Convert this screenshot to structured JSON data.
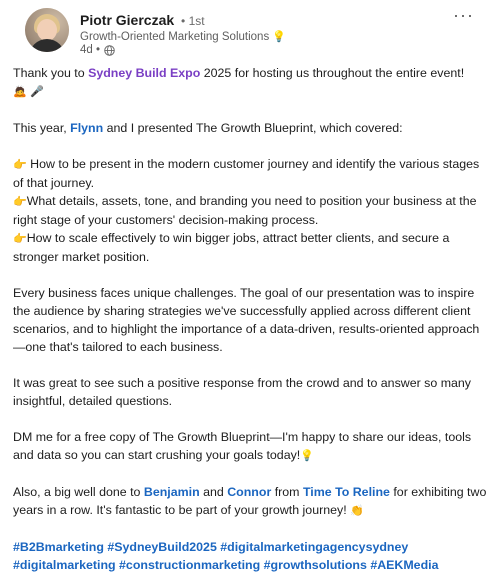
{
  "header": {
    "name": "Piotr Gierczak",
    "degree": "• 1st",
    "headline": "Growth-Oriented Marketing Solutions",
    "headline_emoji": "💡",
    "time": "4d •",
    "more": "···"
  },
  "post": {
    "line1_pre": "Thank you to ",
    "line1_tag": "Sydney Build Expo",
    "line1_post": " 2025 for hosting us throughout the entire event!",
    "line1_emoji": "🙇 🎤",
    "line2_pre": "This year, ",
    "line2_tag": "Flynn",
    "line2_post": " and I presented The Growth Blueprint, which covered:",
    "bullet_emoji": "👉",
    "bullet1": " How to be present in the modern customer journey and identify the various stages of that journey.",
    "bullet2": "What details, assets, tone, and branding you need to position your business at the right stage of your customers' decision-making process.",
    "bullet3": "How to scale effectively to win bigger jobs, attract better clients, and secure a stronger market position.",
    "para1": "Every business faces unique challenges. The goal of our presentation was to inspire the audience by sharing strategies we've successfully applied across different client scenarios, and to highlight the importance of a data-driven, results-oriented approach—one that's tailored to each business.",
    "para2": "It was great to see such a positive response from the crowd and to answer so many insightful, detailed questions.",
    "para3": "DM me for a free copy of The Growth Blueprint—I'm happy to share our ideas, tools and data so you can start crushing your goals today!",
    "para3_emoji": "💡",
    "para4_pre": "Also, a big well done to ",
    "para4_tag1": "Benjamin",
    "para4_mid1": " and ",
    "para4_tag2": "Connor",
    "para4_mid2": " from ",
    "para4_tag3": "Time To Reline",
    "para4_post": " for exhibiting two years in a row. It's fantastic to be part of your growth journey!",
    "para4_emoji": "👏",
    "hashtags_line1": "#B2Bmarketing #SydneyBuild2025 #digitalmarketingagencysydney",
    "hashtags_line2": "#digitalmarketing #constructionmarketing #growthsolutions #AEKMedia"
  },
  "colors": {
    "company_tag": "#7a3fc4",
    "mention": "#1b66c0",
    "hashtag": "#1b66c0"
  }
}
